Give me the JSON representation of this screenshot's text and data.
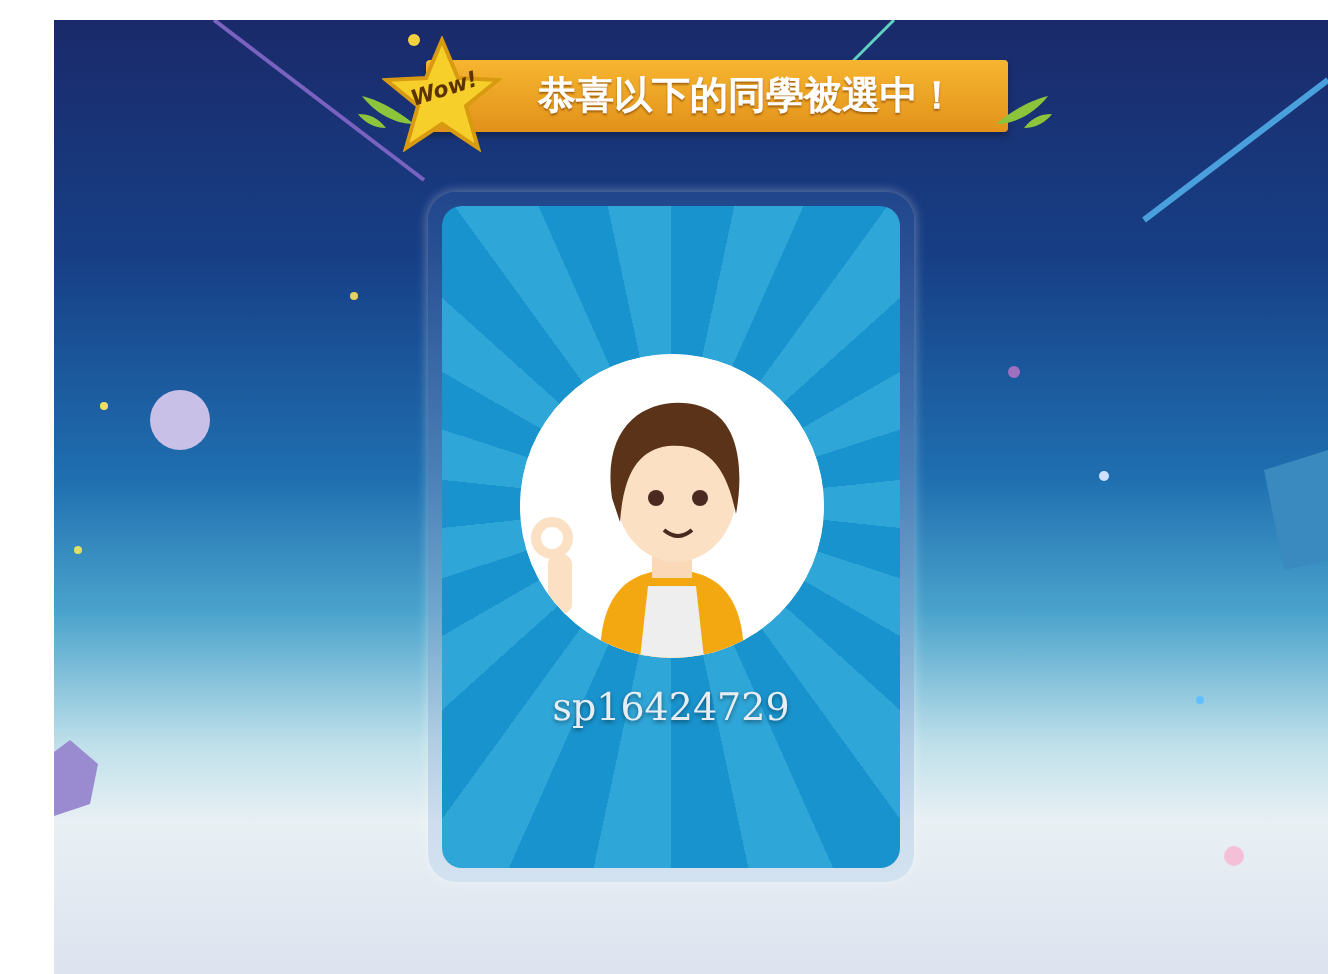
{
  "banner": {
    "badge": "Wow!",
    "title": "恭喜以下的同學被選中！"
  },
  "selected_student": {
    "username": "sp16424729"
  }
}
